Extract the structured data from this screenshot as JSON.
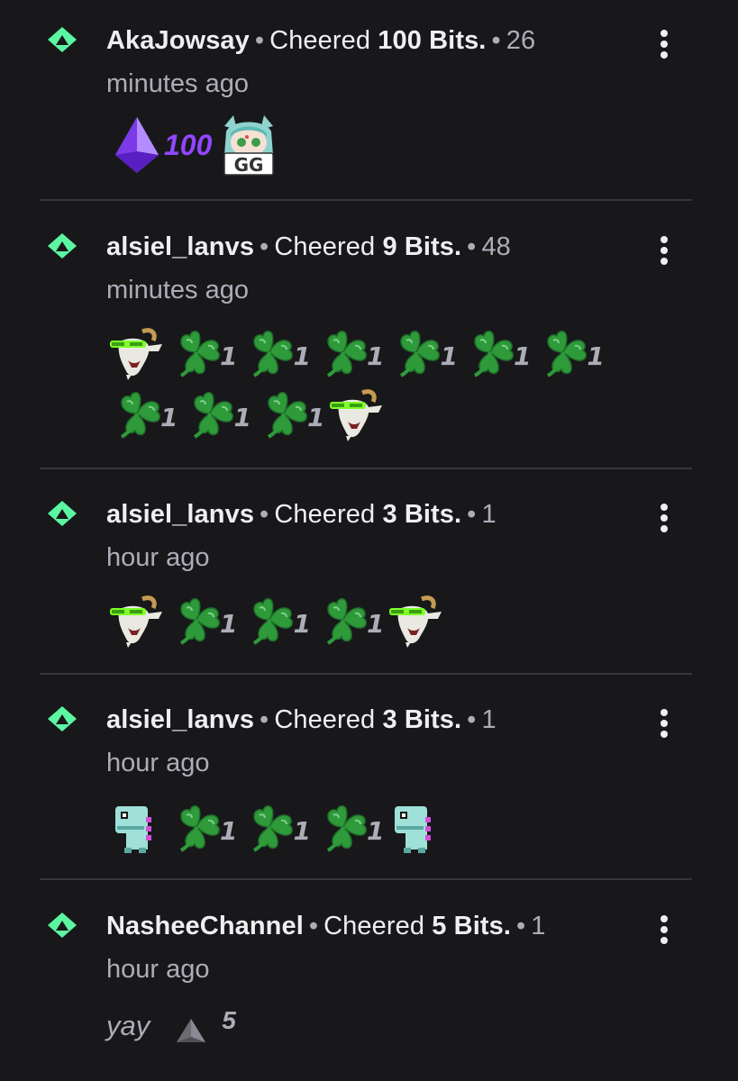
{
  "colors": {
    "background": "#18181b",
    "accent": "#5cf5a2",
    "divider": "#35353b",
    "purple": "#9146ff",
    "clover": "#2e9a3a"
  },
  "events": [
    {
      "user": "AkaJowsay",
      "action": "Cheered",
      "bits": "100 Bits.",
      "time_a": "26",
      "time_b": "minutes ago",
      "message": {
        "cheer_count": "100",
        "emotes": [
          "purple-gem-icon",
          "gg-anime-emote"
        ]
      }
    },
    {
      "user": "alsiel_lanvs",
      "action": "Cheered",
      "bits": "9 Bits.",
      "time_a": "48",
      "time_b": "minutes ago",
      "message": {
        "clover_count": "1",
        "row1_clovers": 6,
        "row2_clovers": 3,
        "emotes": [
          "goat-emote"
        ]
      }
    },
    {
      "user": "alsiel_lanvs",
      "action": "Cheered",
      "bits": "3 Bits.",
      "time_a": "1",
      "time_b": "hour ago",
      "message": {
        "clover_count": "1",
        "clovers": 3,
        "emotes": [
          "goat-emote"
        ]
      }
    },
    {
      "user": "alsiel_lanvs",
      "action": "Cheered",
      "bits": "3 Bits.",
      "time_a": "1",
      "time_b": "hour ago",
      "message": {
        "clover_count": "1",
        "clovers": 3,
        "emotes": [
          "dino-emote"
        ]
      }
    },
    {
      "user": "NasheeChannel",
      "action": "Cheered",
      "bits": "5 Bits.",
      "time_a": "1",
      "time_b": "hour ago",
      "message": {
        "text": "yay",
        "cheer_count": "5",
        "emotes": [
          "grey-bits-icon"
        ]
      }
    }
  ],
  "icons": {
    "cheer": "cheer-diamond-icon",
    "menu": "more-vertical-icon",
    "clover": "clover-icon"
  }
}
